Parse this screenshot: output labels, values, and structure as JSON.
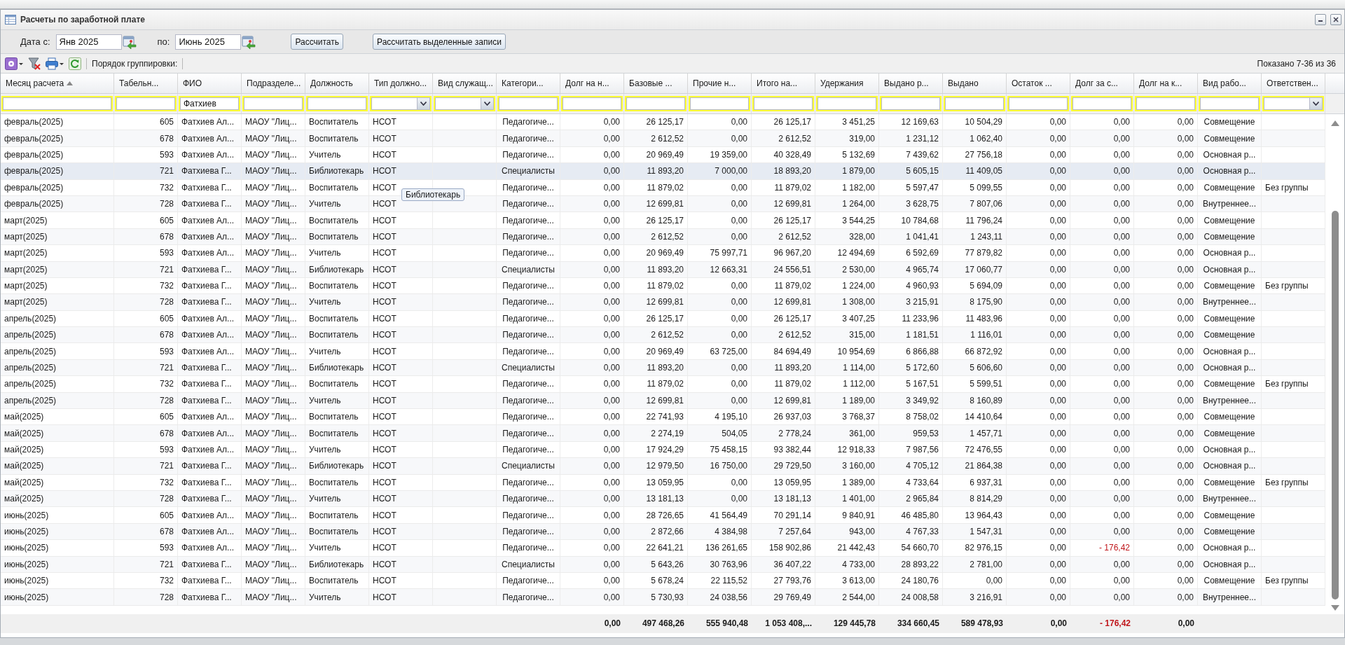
{
  "window": {
    "title": "Расчеты по заработной плате"
  },
  "period": {
    "from_label": "Дата с:",
    "from": "Янв 2025",
    "to_label": "по:",
    "to": "Июнь 2025"
  },
  "actions": [
    "Рассчитать",
    "Рассчитать выделенные записи"
  ],
  "toolbar": {
    "grouping_label": "Порядок группировки:",
    "paging": "Показано 7-36 из 36"
  },
  "tooltip": "Библиотекарь",
  "table": {
    "columns": [
      {
        "label": "Месяц расчета",
        "kind": "text",
        "filter": {
          "kind": "text"
        },
        "sorted_ascending": true
      },
      {
        "label": "Табельн...",
        "kind": "number",
        "filter": {
          "kind": "text"
        },
        "sorted_ascending": false
      },
      {
        "label": "ФИО",
        "kind": "text",
        "filter": {
          "kind": "text",
          "value": "Фатхиев"
        },
        "sorted_ascending": false
      },
      {
        "label": "Подразделе...",
        "kind": "text",
        "filter": {
          "kind": "text"
        },
        "sorted_ascending": false
      },
      {
        "label": "Должность",
        "kind": "text",
        "filter": {
          "kind": "text"
        },
        "sorted_ascending": false
      },
      {
        "label": "Тип должно...",
        "kind": "text",
        "filter": {
          "kind": "combo"
        },
        "sorted_ascending": false
      },
      {
        "label": "Вид служащ...",
        "filter": {
          "kind": "combo"
        },
        "sorted_ascending": false
      },
      {
        "label": "Категори...",
        "kind": "center",
        "filter": {
          "kind": "text"
        },
        "sorted_ascending": false
      },
      {
        "label": "Долг на н...",
        "kind": "number",
        "filter": {
          "kind": "text"
        },
        "sorted_ascending": false,
        "totalled": true
      },
      {
        "label": "Базовые ...",
        "kind": "number",
        "filter": {
          "kind": "text"
        },
        "sorted_ascending": false,
        "totalled": true
      },
      {
        "label": "Прочие н...",
        "kind": "number",
        "filter": {
          "kind": "text"
        },
        "sorted_ascending": false,
        "totalled": true
      },
      {
        "label": "Итого на...",
        "kind": "number",
        "filter": {
          "kind": "text"
        },
        "sorted_ascending": false,
        "totalled": true
      },
      {
        "label": "Удержания",
        "kind": "number",
        "filter": {
          "kind": "text"
        },
        "sorted_ascending": false,
        "totalled": true
      },
      {
        "label": "Выдано р...",
        "kind": "number",
        "filter": {
          "kind": "text"
        },
        "sorted_ascending": false,
        "totalled": true
      },
      {
        "label": "Выдано",
        "kind": "number",
        "filter": {
          "kind": "text"
        },
        "sorted_ascending": false,
        "totalled": true
      },
      {
        "label": "Остаток ...",
        "kind": "number",
        "filter": {
          "kind": "text"
        },
        "sorted_ascending": false,
        "totalled": true
      },
      {
        "label": "Долг за с...",
        "kind": "number",
        "filter": {
          "kind": "text"
        },
        "sorted_ascending": false,
        "totalled": true
      },
      {
        "label": "Долг на к...",
        "kind": "number",
        "filter": {
          "kind": "text"
        },
        "sorted_ascending": false,
        "totalled": true
      },
      {
        "label": "Вид рабо...",
        "kind": "center",
        "filter": {
          "kind": "text"
        },
        "sorted_ascending": false
      },
      {
        "label": "Ответствен...",
        "kind": "text",
        "filter": {
          "kind": "combo"
        },
        "sorted_ascending": false
      }
    ],
    "rows": [
      {
        "selected": false,
        "cells": [
          "февраль(2025)",
          "605",
          "Фатхиев Ал...",
          "МАОУ \"Лиц...",
          "Воспитатель",
          "НСОТ",
          null,
          "Педагогиче...",
          "0,00",
          "26 125,17",
          "0,00",
          "26 125,17",
          "3 451,25",
          "12 169,63",
          "10 504,29",
          "0,00",
          "0,00",
          "0,00",
          "Совмещение",
          null
        ]
      },
      {
        "selected": false,
        "cells": [
          "февраль(2025)",
          "678",
          "Фатхиев Ал...",
          "МАОУ \"Лиц...",
          "Воспитатель",
          "НСОТ",
          null,
          "Педагогиче...",
          "0,00",
          "2 612,52",
          "0,00",
          "2 612,52",
          "319,00",
          "1 231,12",
          "1 062,40",
          "0,00",
          "0,00",
          "0,00",
          "Совмещение",
          null
        ]
      },
      {
        "selected": false,
        "cells": [
          "февраль(2025)",
          "593",
          "Фатхиев Ал...",
          "МАОУ \"Лиц...",
          "Учитель",
          "НСОТ",
          null,
          "Педагогиче...",
          "0,00",
          "20 969,49",
          "19 359,00",
          "40 328,49",
          "5 132,69",
          "7 439,62",
          "27 756,18",
          "0,00",
          "0,00",
          "0,00",
          "Основная р...",
          null
        ]
      },
      {
        "selected": true,
        "cells": [
          "февраль(2025)",
          "721",
          "Фатхиева Г...",
          "МАОУ \"Лиц...",
          "Библиотекарь",
          "НСОТ",
          null,
          "Специалисты",
          "0,00",
          "11 893,20",
          "7 000,00",
          "18 893,20",
          "1 879,00",
          "5 605,15",
          "11 409,05",
          "0,00",
          "0,00",
          "0,00",
          "Основная р...",
          null
        ]
      },
      {
        "selected": false,
        "cells": [
          "февраль(2025)",
          "732",
          "Фатхиева Г...",
          "МАОУ \"Лиц...",
          "Воспитатель",
          "НСОТ",
          null,
          "Педагогиче...",
          "0,00",
          "11 879,02",
          "0,00",
          "11 879,02",
          "1 182,00",
          "5 597,47",
          "5 099,55",
          "0,00",
          "0,00",
          "0,00",
          "Совмещение",
          "Без группы"
        ]
      },
      {
        "selected": false,
        "cells": [
          "февраль(2025)",
          "728",
          "Фатхиева Г...",
          "МАОУ \"Лиц...",
          "Учитель",
          "НСОТ",
          null,
          "Педагогиче...",
          "0,00",
          "12 699,81",
          "0,00",
          "12 699,81",
          "1 264,00",
          "3 628,75",
          "7 807,06",
          "0,00",
          "0,00",
          "0,00",
          "Внутреннее...",
          null
        ]
      },
      {
        "selected": false,
        "cells": [
          "март(2025)",
          "605",
          "Фатхиев Ал...",
          "МАОУ \"Лиц...",
          "Воспитатель",
          "НСОТ",
          null,
          "Педагогиче...",
          "0,00",
          "26 125,17",
          "0,00",
          "26 125,17",
          "3 544,25",
          "10 784,68",
          "11 796,24",
          "0,00",
          "0,00",
          "0,00",
          "Совмещение",
          null
        ]
      },
      {
        "selected": false,
        "cells": [
          "март(2025)",
          "678",
          "Фатхиев Ал...",
          "МАОУ \"Лиц...",
          "Воспитатель",
          "НСОТ",
          null,
          "Педагогиче...",
          "0,00",
          "2 612,52",
          "0,00",
          "2 612,52",
          "328,00",
          "1 041,41",
          "1 243,11",
          "0,00",
          "0,00",
          "0,00",
          "Совмещение",
          null
        ]
      },
      {
        "selected": false,
        "cells": [
          "март(2025)",
          "593",
          "Фатхиев Ал...",
          "МАОУ \"Лиц...",
          "Учитель",
          "НСОТ",
          null,
          "Педагогиче...",
          "0,00",
          "20 969,49",
          "75 997,71",
          "96 967,20",
          "12 494,69",
          "6 592,69",
          "77 879,82",
          "0,00",
          "0,00",
          "0,00",
          "Основная р...",
          null
        ]
      },
      {
        "selected": false,
        "cells": [
          "март(2025)",
          "721",
          "Фатхиева Г...",
          "МАОУ \"Лиц...",
          "Библиотекарь",
          "НСОТ",
          null,
          "Специалисты",
          "0,00",
          "11 893,20",
          "12 663,31",
          "24 556,51",
          "2 530,00",
          "4 965,74",
          "17 060,77",
          "0,00",
          "0,00",
          "0,00",
          "Основная р...",
          null
        ]
      },
      {
        "selected": false,
        "cells": [
          "март(2025)",
          "732",
          "Фатхиева Г...",
          "МАОУ \"Лиц...",
          "Воспитатель",
          "НСОТ",
          null,
          "Педагогиче...",
          "0,00",
          "11 879,02",
          "0,00",
          "11 879,02",
          "1 224,00",
          "4 960,93",
          "5 694,09",
          "0,00",
          "0,00",
          "0,00",
          "Совмещение",
          "Без группы"
        ]
      },
      {
        "selected": false,
        "cells": [
          "март(2025)",
          "728",
          "Фатхиева Г...",
          "МАОУ \"Лиц...",
          "Учитель",
          "НСОТ",
          null,
          "Педагогиче...",
          "0,00",
          "12 699,81",
          "0,00",
          "12 699,81",
          "1 308,00",
          "3 215,91",
          "8 175,90",
          "0,00",
          "0,00",
          "0,00",
          "Внутреннее...",
          null
        ]
      },
      {
        "selected": false,
        "cells": [
          "апрель(2025)",
          "605",
          "Фатхиев Ал...",
          "МАОУ \"Лиц...",
          "Воспитатель",
          "НСОТ",
          null,
          "Педагогиче...",
          "0,00",
          "26 125,17",
          "0,00",
          "26 125,17",
          "3 407,25",
          "11 233,96",
          "11 483,96",
          "0,00",
          "0,00",
          "0,00",
          "Совмещение",
          null
        ]
      },
      {
        "selected": false,
        "cells": [
          "апрель(2025)",
          "678",
          "Фатхиев Ал...",
          "МАОУ \"Лиц...",
          "Воспитатель",
          "НСОТ",
          null,
          "Педагогиче...",
          "0,00",
          "2 612,52",
          "0,00",
          "2 612,52",
          "315,00",
          "1 181,51",
          "1 116,01",
          "0,00",
          "0,00",
          "0,00",
          "Совмещение",
          null
        ]
      },
      {
        "selected": false,
        "cells": [
          "апрель(2025)",
          "593",
          "Фатхиев Ал...",
          "МАОУ \"Лиц...",
          "Учитель",
          "НСОТ",
          null,
          "Педагогиче...",
          "0,00",
          "20 969,49",
          "63 725,00",
          "84 694,49",
          "10 954,69",
          "6 866,88",
          "66 872,92",
          "0,00",
          "0,00",
          "0,00",
          "Основная р...",
          null
        ]
      },
      {
        "selected": false,
        "cells": [
          "апрель(2025)",
          "721",
          "Фатхиева Г...",
          "МАОУ \"Лиц...",
          "Библиотекарь",
          "НСОТ",
          null,
          "Специалисты",
          "0,00",
          "11 893,20",
          "0,00",
          "11 893,20",
          "1 114,00",
          "5 172,60",
          "5 606,60",
          "0,00",
          "0,00",
          "0,00",
          "Основная р...",
          null
        ]
      },
      {
        "selected": false,
        "cells": [
          "апрель(2025)",
          "732",
          "Фатхиева Г...",
          "МАОУ \"Лиц...",
          "Воспитатель",
          "НСОТ",
          null,
          "Педагогиче...",
          "0,00",
          "11 879,02",
          "0,00",
          "11 879,02",
          "1 112,00",
          "5 167,51",
          "5 599,51",
          "0,00",
          "0,00",
          "0,00",
          "Совмещение",
          "Без группы"
        ]
      },
      {
        "selected": false,
        "cells": [
          "апрель(2025)",
          "728",
          "Фатхиева Г...",
          "МАОУ \"Лиц...",
          "Учитель",
          "НСОТ",
          null,
          "Педагогиче...",
          "0,00",
          "12 699,81",
          "0,00",
          "12 699,81",
          "1 189,00",
          "3 349,92",
          "8 160,89",
          "0,00",
          "0,00",
          "0,00",
          "Внутреннее...",
          null
        ]
      },
      {
        "selected": false,
        "cells": [
          "май(2025)",
          "605",
          "Фатхиев Ал...",
          "МАОУ \"Лиц...",
          "Воспитатель",
          "НСОТ",
          null,
          "Педагогиче...",
          "0,00",
          "22 741,93",
          "4 195,10",
          "26 937,03",
          "3 768,37",
          "8 758,02",
          "14 410,64",
          "0,00",
          "0,00",
          "0,00",
          "Совмещение",
          null
        ]
      },
      {
        "selected": false,
        "cells": [
          "май(2025)",
          "678",
          "Фатхиев Ал...",
          "МАОУ \"Лиц...",
          "Воспитатель",
          "НСОТ",
          null,
          "Педагогиче...",
          "0,00",
          "2 274,19",
          "504,05",
          "2 778,24",
          "361,00",
          "959,53",
          "1 457,71",
          "0,00",
          "0,00",
          "0,00",
          "Совмещение",
          null
        ]
      },
      {
        "selected": false,
        "cells": [
          "май(2025)",
          "593",
          "Фатхиев Ал...",
          "МАОУ \"Лиц...",
          "Учитель",
          "НСОТ",
          null,
          "Педагогиче...",
          "0,00",
          "17 924,29",
          "75 458,15",
          "93 382,44",
          "12 918,33",
          "7 987,56",
          "72 476,55",
          "0,00",
          "0,00",
          "0,00",
          "Основная р...",
          null
        ]
      },
      {
        "selected": false,
        "cells": [
          "май(2025)",
          "721",
          "Фатхиева Г...",
          "МАОУ \"Лиц...",
          "Библиотекарь",
          "НСОТ",
          null,
          "Специалисты",
          "0,00",
          "12 979,50",
          "16 750,00",
          "29 729,50",
          "3 160,00",
          "4 705,12",
          "21 864,38",
          "0,00",
          "0,00",
          "0,00",
          "Основная р...",
          null
        ]
      },
      {
        "selected": false,
        "cells": [
          "май(2025)",
          "732",
          "Фатхиева Г...",
          "МАОУ \"Лиц...",
          "Воспитатель",
          "НСОТ",
          null,
          "Педагогиче...",
          "0,00",
          "13 059,95",
          "0,00",
          "13 059,95",
          "1 389,00",
          "4 733,64",
          "6 937,31",
          "0,00",
          "0,00",
          "0,00",
          "Совмещение",
          "Без группы"
        ]
      },
      {
        "selected": false,
        "cells": [
          "май(2025)",
          "728",
          "Фатхиева Г...",
          "МАОУ \"Лиц...",
          "Учитель",
          "НСОТ",
          null,
          "Педагогиче...",
          "0,00",
          "13 181,13",
          "0,00",
          "13 181,13",
          "1 401,00",
          "2 965,84",
          "8 814,29",
          "0,00",
          "0,00",
          "0,00",
          "Внутреннее...",
          null
        ]
      },
      {
        "selected": false,
        "cells": [
          "июнь(2025)",
          "605",
          "Фатхиев Ал...",
          "МАОУ \"Лиц...",
          "Воспитатель",
          "НСОТ",
          null,
          "Педагогиче...",
          "0,00",
          "28 726,65",
          "41 564,49",
          "70 291,14",
          "9 840,91",
          "46 485,80",
          "13 964,43",
          "0,00",
          "0,00",
          "0,00",
          "Совмещение",
          null
        ]
      },
      {
        "selected": false,
        "cells": [
          "июнь(2025)",
          "678",
          "Фатхиев Ал...",
          "МАОУ \"Лиц...",
          "Воспитатель",
          "НСОТ",
          null,
          "Педагогиче...",
          "0,00",
          "2 872,66",
          "4 384,98",
          "7 257,64",
          "943,00",
          "4 767,33",
          "1 547,31",
          "0,00",
          "0,00",
          "0,00",
          "Совмещение",
          null
        ]
      },
      {
        "selected": false,
        "cells": [
          "июнь(2025)",
          "593",
          "Фатхиев Ал...",
          "МАОУ \"Лиц...",
          "Учитель",
          "НСОТ",
          null,
          "Педагогиче...",
          "0,00",
          "22 641,21",
          "136 261,65",
          "158 902,86",
          "21 442,43",
          "54 660,70",
          "82 976,15",
          "0,00",
          {
            "text": "- 176,42",
            "negative": true
          },
          "0,00",
          "Основная р...",
          null
        ]
      },
      {
        "selected": false,
        "cells": [
          "июнь(2025)",
          "721",
          "Фатхиева Г...",
          "МАОУ \"Лиц...",
          "Библиотекарь",
          "НСОТ",
          null,
          "Специалисты",
          "0,00",
          "5 643,26",
          "30 763,96",
          "36 407,22",
          "4 733,00",
          "28 893,22",
          "2 781,00",
          "0,00",
          "0,00",
          "0,00",
          "Основная р...",
          null
        ]
      },
      {
        "selected": false,
        "cells": [
          "июнь(2025)",
          "732",
          "Фатхиева Г...",
          "МАОУ \"Лиц...",
          "Воспитатель",
          "НСОТ",
          null,
          "Педагогиче...",
          "0,00",
          "5 678,24",
          "22 115,52",
          "27 793,76",
          "3 613,00",
          "24 180,76",
          "0,00",
          "0,00",
          "0,00",
          "0,00",
          "Совмещение",
          "Без группы"
        ]
      },
      {
        "selected": false,
        "cells": [
          "июнь(2025)",
          "728",
          "Фатхиева Г...",
          "МАОУ \"Лиц...",
          "Учитель",
          "НСОТ",
          null,
          "Педагогиче...",
          "0,00",
          "5 730,93",
          "24 038,56",
          "29 769,49",
          "2 544,00",
          "24 008,58",
          "3 216,91",
          "0,00",
          "0,00",
          "0,00",
          "Внутреннее...",
          null
        ]
      }
    ],
    "totals": [
      {
        "text": "0,00",
        "negative": false
      },
      {
        "text": "497 468,26",
        "negative": false
      },
      {
        "text": "555 940,48",
        "negative": false
      },
      {
        "text": "1 053 408,...",
        "negative": false
      },
      {
        "text": "129 445,78",
        "negative": false
      },
      {
        "text": "334 660,45",
        "negative": false
      },
      {
        "text": "589 478,93",
        "negative": false
      },
      {
        "text": "0,00",
        "negative": false
      },
      {
        "text": "- 176,42",
        "negative": true
      },
      {
        "text": "0,00",
        "negative": false
      }
    ]
  }
}
